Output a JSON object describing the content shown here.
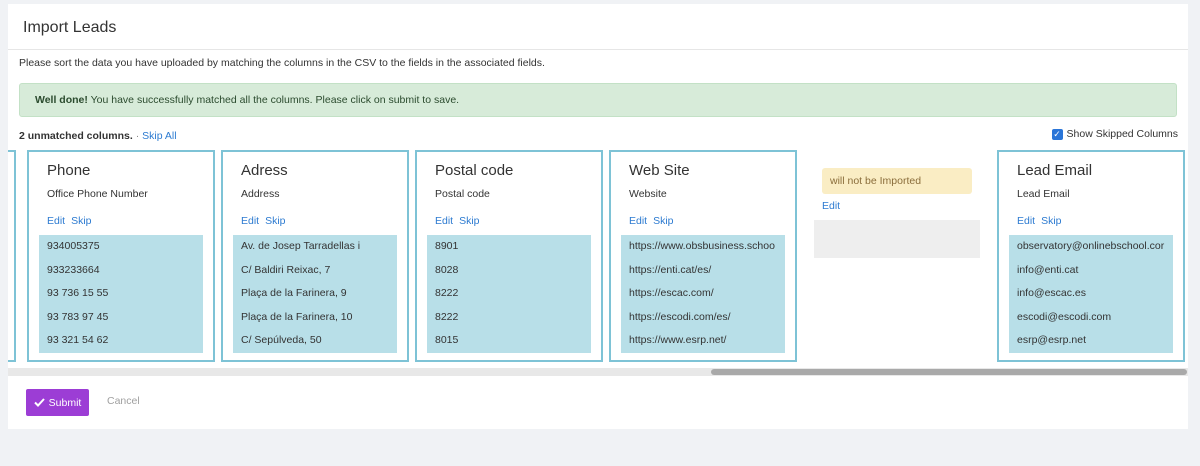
{
  "header": {
    "title": "Import Leads"
  },
  "instructions": "Please sort the data you have uploaded by matching the columns in the CSV to the fields in the associated fields.",
  "alert": {
    "strong": "Well done!",
    "text": " You have successfully matched all the columns. Please click on submit to save."
  },
  "status": {
    "unmatched": "2 unmatched columns.",
    "separator": " · ",
    "skip_all": "Skip All",
    "show_skipped_label": "Show Skipped Columns",
    "show_skipped_checked": true
  },
  "actions": {
    "edit": "Edit",
    "skip": "Skip"
  },
  "columns": [
    {
      "title": "Phone",
      "field": "Office Phone Number",
      "values": [
        "934005375",
        "933233664",
        "93 736 15 55",
        "93 783 97 45",
        "93 321 54 62"
      ]
    },
    {
      "title": "Adress",
      "field": "Address",
      "values": [
        "Av. de Josep Tarradellas i",
        "C/ Baldiri Reixac, 7",
        "Plaça de la Farinera, 9",
        "Plaça de la Farinera, 10",
        "C/ Sepúlveda, 50"
      ]
    },
    {
      "title": "Postal code",
      "field": "Postal code",
      "values": [
        "8901",
        "8028",
        "8222",
        "8222",
        "8015"
      ]
    },
    {
      "title": "Web Site",
      "field": "Website",
      "values": [
        "https://www.obsbusiness.schoo",
        "https://enti.cat/es/",
        "https://escac.com/",
        "https://escodi.com/es/",
        "https://www.esrp.net/"
      ]
    },
    {
      "title": "Lead Email",
      "field": "Lead Email",
      "values": [
        " observatory@onlinebschool.cor",
        "info@enti.cat",
        "info@escac.es",
        "escodi@escodi.com",
        "esrp@esrp.net"
      ]
    }
  ],
  "skipped_column": {
    "notice": "will not be Imported",
    "edit": "Edit"
  },
  "footer": {
    "submit": "Submit",
    "cancel": "Cancel"
  }
}
